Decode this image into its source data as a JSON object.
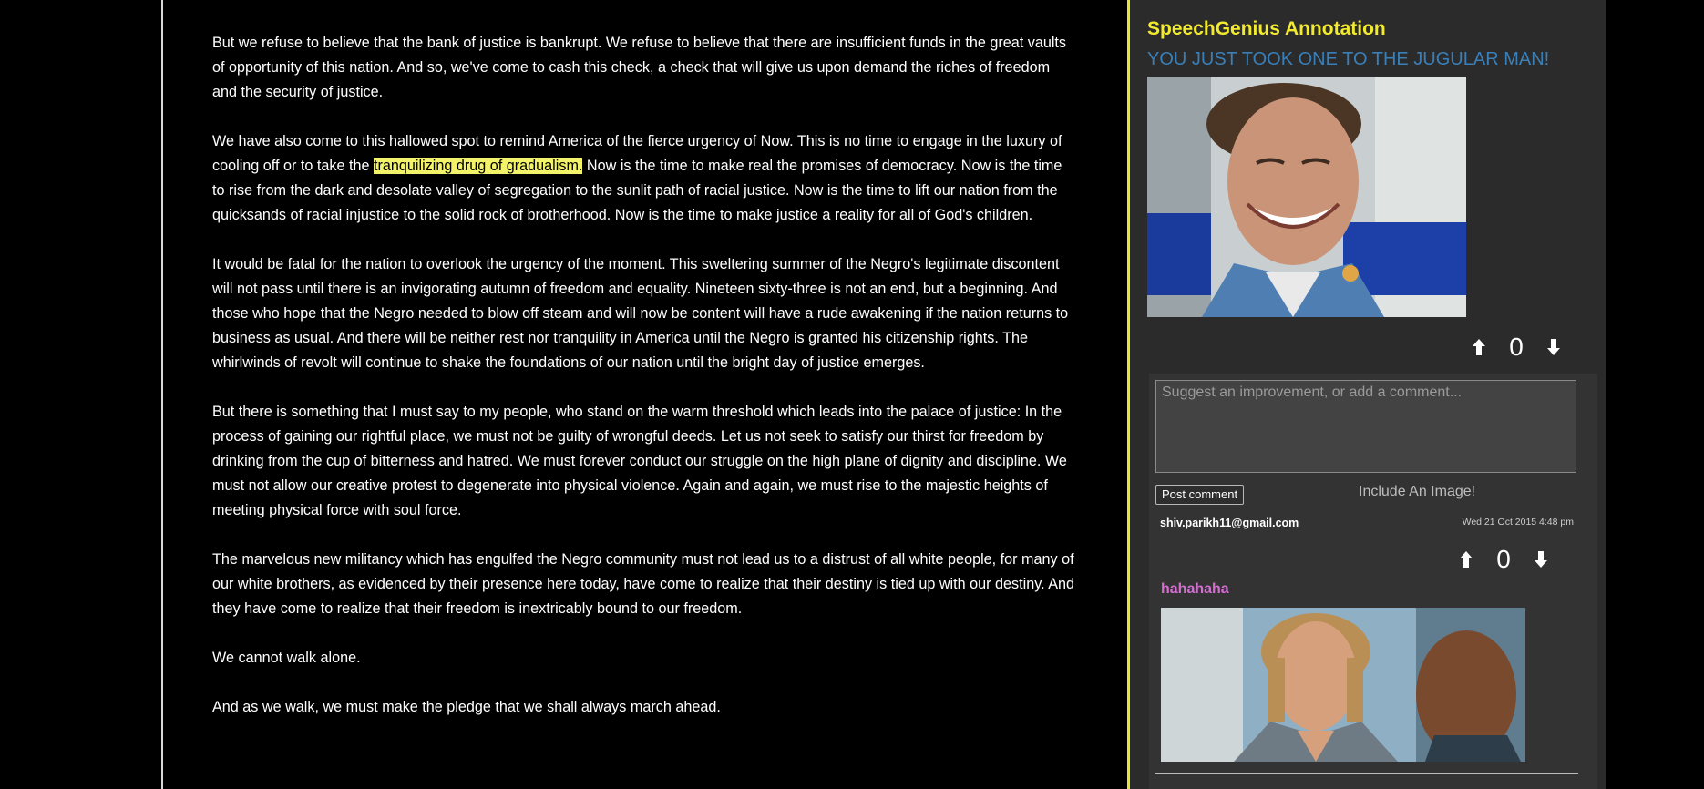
{
  "speech": {
    "p1": "But we refuse to believe that the bank of justice is bankrupt. We refuse to believe that there are insufficient funds in the great vaults of opportunity of this nation. And so, we've come to cash this check, a check that will give us upon demand the riches of freedom and the security of justice.",
    "p2_before": "We have also come to this hallowed spot to remind America of the fierce urgency of Now. This is no time to engage in the luxury of cooling off or to take the ",
    "p2_highlight": "tranquilizing drug of gradualism.",
    "p2_after": " Now is the time to make real the promises of democracy. Now is the time to rise from the dark and desolate valley of segregation to the sunlit path of racial justice. Now is the time to lift our nation from the quicksands of racial injustice to the solid rock of brotherhood. Now is the time to make justice a reality for all of God's children.",
    "p3": "It would be fatal for the nation to overlook the urgency of the moment. This sweltering summer of the Negro's legitimate discontent will not pass until there is an invigorating autumn of freedom and equality. Nineteen sixty-three is not an end, but a beginning. And those who hope that the Negro needed to blow off steam and will now be content will have a rude awakening if the nation returns to business as usual. And there will be neither rest nor tranquility in America until the Negro is granted his citizenship rights. The whirlwinds of revolt will continue to shake the foundations of our nation until the bright day of justice emerges.",
    "p4": "But there is something that I must say to my people, who stand on the warm threshold which leads into the palace of justice: In the process of gaining our rightful place, we must not be guilty of wrongful deeds. Let us not seek to satisfy our thirst for freedom by drinking from the cup of bitterness and hatred. We must forever conduct our struggle on the high plane of dignity and discipline. We must not allow our creative protest to degenerate into physical violence. Again and again, we must rise to the majestic heights of meeting physical force with soul force.",
    "p5": "The marvelous new militancy which has engulfed the Negro community must not lead us to a distrust of all white people, for many of our white brothers, as evidenced by their presence here today, have come to realize that their destiny is tied up with our destiny. And they have come to realize that their freedom is inextricably bound to our freedom.",
    "p6": "We cannot walk alone.",
    "p7": "And as we walk, we must make the pledge that we shall always march ahead."
  },
  "annotation": {
    "title": "SpeechGenius Annotation",
    "subtitle": "YOU JUST TOOK ONE TO THE JUGULAR MAN!",
    "image_icon": "laughing-man-photo",
    "vote_count": "0"
  },
  "comment_form": {
    "placeholder": "Suggest an improvement, or add a comment...",
    "post_label": "Post comment",
    "include_image_label": "Include An Image!"
  },
  "comments": [
    {
      "author": "shiv.parikh11@gmail.com",
      "date": "Wed 21 Oct 2015 4:48 pm",
      "vote_count": "0",
      "text": "hahahaha",
      "image_icon": "mullet-man-photo"
    }
  ],
  "colors": {
    "highlight": "#f3f36a",
    "title": "#f2ea2e",
    "subtitle": "#3a7fb8",
    "comment_text": "#d36fcf",
    "panel_bg": "#2b2b2b",
    "panel_border": "#e6e63a"
  }
}
